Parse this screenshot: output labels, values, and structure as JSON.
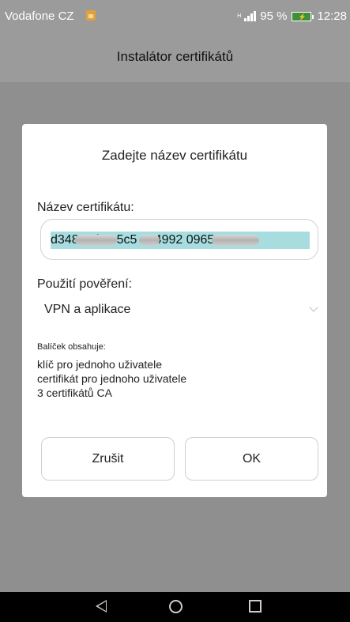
{
  "status_bar": {
    "carrier": "Vodafone CZ",
    "network_type": "H",
    "battery_percent": "95 %",
    "time": "12:28"
  },
  "app": {
    "title": "Instalátor certifikátů"
  },
  "dialog": {
    "title": "Zadejte název certifikátu",
    "name_label": "Název certifikátu:",
    "name_value": "d3488 1b6c5c5 454992 0965",
    "usage_label": "Použití pověření:",
    "usage_value": "VPN a aplikace",
    "contains_label": "Balíček obsahuje:",
    "contains_items": [
      "klíč pro jednoho uživatele",
      "certifikát pro jednoho uživatele",
      "3 certifikátů CA"
    ],
    "cancel_label": "Zrušit",
    "ok_label": "OK"
  },
  "colors": {
    "selection": "#a8dde0",
    "battery": "#3d8f3a",
    "sim": "#e2a13a"
  },
  "icons": [
    "sim-icon",
    "signal-icon",
    "battery-icon",
    "chevron-down-icon",
    "back-icon",
    "home-icon",
    "recents-icon"
  ]
}
